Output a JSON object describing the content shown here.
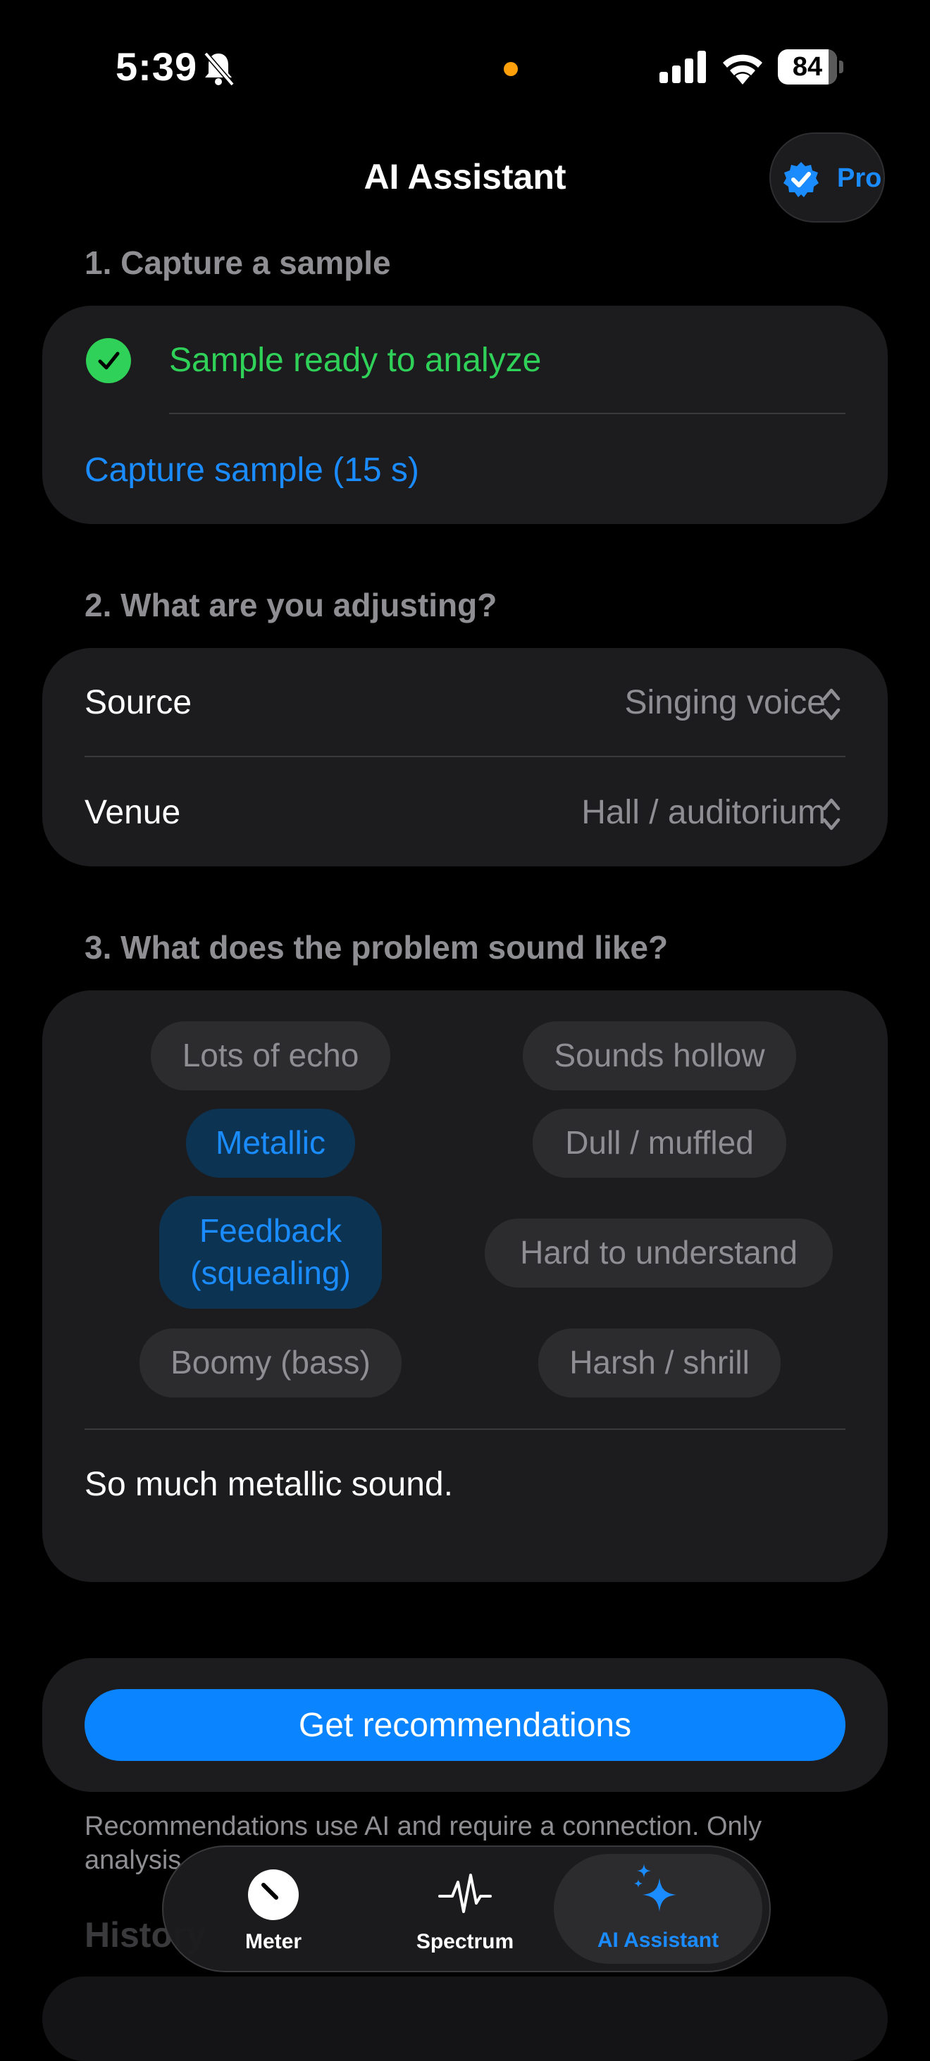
{
  "status_bar": {
    "time": "5:39",
    "battery": "84"
  },
  "header": {
    "title": "AI Assistant",
    "pro_label": "Pro"
  },
  "sections": {
    "capture": {
      "title": "1. Capture a sample",
      "ready_text": "Sample ready to analyze",
      "capture_button": "Capture sample (15 s)"
    },
    "adjusting": {
      "title": "2. What are you adjusting?",
      "rows": [
        {
          "label": "Source",
          "value": "Singing voice"
        },
        {
          "label": "Venue",
          "value": "Hall / auditorium"
        }
      ]
    },
    "problem": {
      "title": "3. What does the problem sound like?",
      "chips": [
        {
          "label": "Lots of echo",
          "selected": false
        },
        {
          "label": "Sounds hollow",
          "selected": false
        },
        {
          "label": "Metallic",
          "selected": true
        },
        {
          "label": "Dull / muffled",
          "selected": false
        },
        {
          "label": "Feedback (squealing)",
          "selected": true
        },
        {
          "label": "Hard to understand",
          "selected": false
        },
        {
          "label": "Boomy (bass)",
          "selected": false
        },
        {
          "label": "Harsh / shrill",
          "selected": false
        }
      ],
      "note": "So much metallic sound."
    }
  },
  "actions": {
    "get_recommendations": "Get recommendations",
    "disclaimer_line1": "Recommendations use AI and require a connection. Only",
    "disclaimer_line2": "analysis"
  },
  "history": {
    "title": "History"
  },
  "tab_bar": {
    "tabs": [
      {
        "label": "Meter",
        "active": false
      },
      {
        "label": "Spectrum",
        "active": false
      },
      {
        "label": "AI Assistant",
        "active": true
      }
    ]
  },
  "colors": {
    "accent": "#0a84ff",
    "success": "#30d158",
    "card": "#1c1c1e",
    "muted": "#8e8e93"
  }
}
